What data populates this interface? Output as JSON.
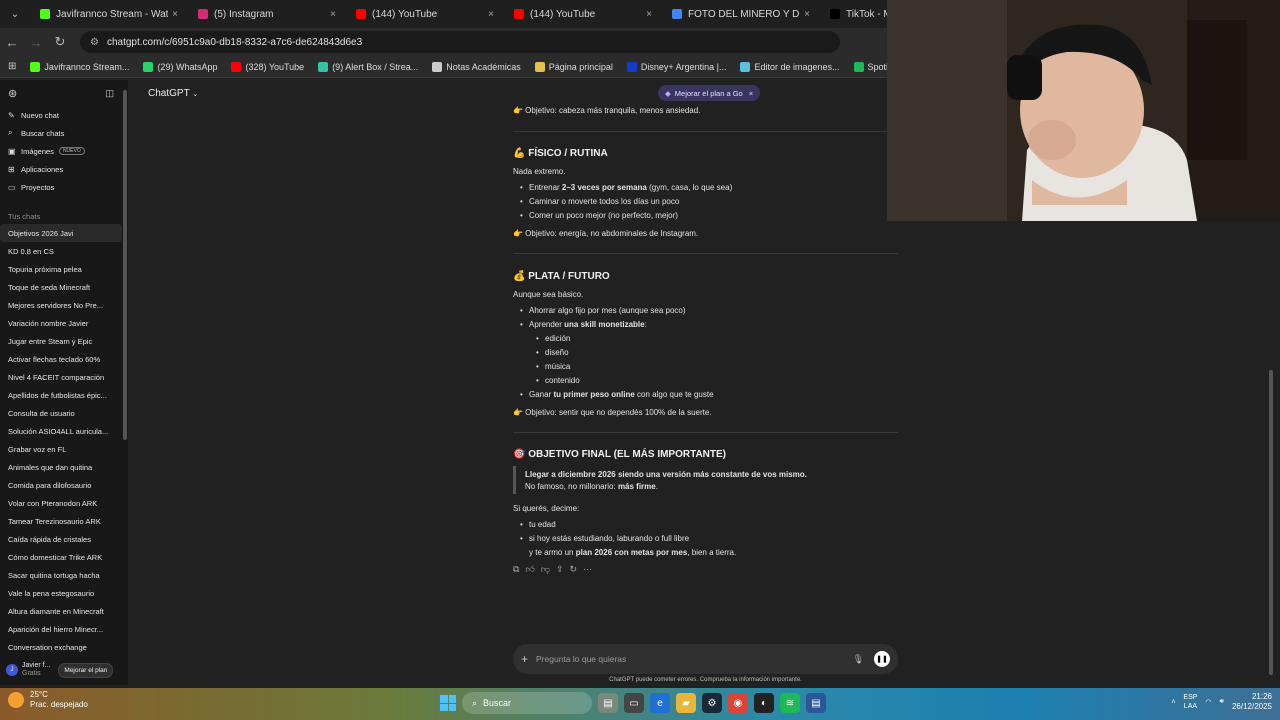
{
  "browser": {
    "tabs": [
      {
        "title": "Javifrannco Stream - Watch Live",
        "color": "#53fc18",
        "active": false
      },
      {
        "title": "(5) Instagram",
        "color": "#d62976",
        "active": false
      },
      {
        "title": "(144) YouTube",
        "color": "#ff0000",
        "active": false
      },
      {
        "title": "(144) YouTube",
        "color": "#ff0000",
        "active": false
      },
      {
        "title": "FOTO DEL MINERO Y DIAMANTE",
        "color": "#4285f4",
        "active": false
      },
      {
        "title": "TikTok - Make",
        "color": "#000000",
        "active": false
      }
    ],
    "url": "chatgpt.com/c/6951c9a0-db18-8332-a7c6-de624843d6e3",
    "bookmarks": [
      {
        "label": "Javifrannco Stream...",
        "color": "#53fc18"
      },
      {
        "label": "(29) WhatsApp",
        "color": "#25d366"
      },
      {
        "label": "(328) YouTube",
        "color": "#ff0000"
      },
      {
        "label": "(9) Alert Box / Strea...",
        "color": "#31c3a2"
      },
      {
        "label": "Notas Académicas",
        "color": "#cccccc"
      },
      {
        "label": "Página principal",
        "color": "#e5c04a"
      },
      {
        "label": "Disney+ Argentina |...",
        "color": "#113ccf"
      },
      {
        "label": "Editor de imagenes...",
        "color": "#5bc0de"
      },
      {
        "label": "Spotify - Reproduct...",
        "color": "#1db954"
      }
    ]
  },
  "sidebar": {
    "top_items": [
      {
        "icon": "edit-icon",
        "glyph": "✎",
        "label": "Nuevo chat"
      },
      {
        "icon": "search-icon",
        "glyph": "⌕",
        "label": "Buscar chats"
      },
      {
        "icon": "image-icon",
        "glyph": "▣",
        "label": "Imágenes",
        "badge": "NUEVO"
      },
      {
        "icon": "apps-icon",
        "glyph": "⊞",
        "label": "Aplicaciones"
      },
      {
        "icon": "folder-icon",
        "glyph": "▭",
        "label": "Proyectos"
      }
    ],
    "section_label": "Tus chats",
    "chats": [
      "Objetivos 2026 Javi",
      "KD 0.8 en CS",
      "Topuria próxima pelea",
      "Toque de seda Minecraft",
      "Mejores servidores No Pre...",
      "Variación nombre Javier",
      "Jugar entre Steam y Epic",
      "Activar flechas teclado 60%",
      "Nivel 4 FACEIT comparación",
      "Apellidos de futbolistas épic...",
      "Consulta de usuario",
      "Solución ASIO4ALL auricula...",
      "Grabar voz en FL",
      "Animales que dan quitina",
      "Comida para dilofosaurio",
      "Volar con Pteranodon ARK",
      "Tamear Terezinosaurio ARK",
      "Caída rápida de cristales",
      "Cómo domesticar Trike ARK",
      "Sacar quitina tortuga hacha",
      "Vale la pena estegosaurio",
      "Altura diamante en Minecraft",
      "Aparición del hierro Minecr...",
      "Conversation exchange"
    ],
    "user_name": "Javier f...",
    "user_plan": "Gratis",
    "upgrade_label": "Mejorar el plan"
  },
  "header": {
    "model": "ChatGPT",
    "go_badge": "Mejorar el plan a Go"
  },
  "message": {
    "line_top": "👉 Objetivo: cabeza más tranquila, menos ansiedad.",
    "fisico_title": "💪 FÍSICO / RUTINA",
    "fisico_intro": "Nada extremo.",
    "fisico_items": [
      {
        "pre": "Entrenar ",
        "bold": "2–3 veces por semana",
        "post": " (gym, casa, lo que sea)"
      },
      {
        "pre": "Caminar o moverte todos los días un poco",
        "bold": "",
        "post": ""
      },
      {
        "pre": "Comer un poco mejor (no perfecto, mejor)",
        "bold": "",
        "post": ""
      }
    ],
    "fisico_goal": "👉 Objetivo: energía, no abdominales de Instagram.",
    "plata_title": "💰 PLATA / FUTURO",
    "plata_intro": "Aunque sea básico.",
    "plata_item1": "Ahorrar algo fijo por mes (aunque sea poco)",
    "plata_item2_pre": "Aprender ",
    "plata_item2_bold": "una skill monetizable",
    "plata_item2_post": ":",
    "skills": [
      "edición",
      "diseño",
      "música",
      "contenido"
    ],
    "plata_item3_pre": "Ganar ",
    "plata_item3_bold": "tu primer peso online",
    "plata_item3_post": " con algo que te guste",
    "plata_goal": "👉 Objetivo: sentir que no dependés 100% de la suerte.",
    "final_title": "🎯 OBJETIVO FINAL (EL MÁS IMPORTANTE)",
    "quote_line1": "Llegar a diciembre 2026 siendo una versión más constante de vos mismo.",
    "quote_line2_pre": "No famoso, no millonario: ",
    "quote_line2_bold": "más firme",
    "quote_line2_post": ".",
    "ask_intro": "Si querés, decime:",
    "ask_item1": "tu edad",
    "ask_item2": "si hoy estás estudiando, laburando o full libre",
    "closing_pre": "y te armo un ",
    "closing_bold": "plan 2026 con metas por mes",
    "closing_post": ", bien a tierra."
  },
  "composer": {
    "placeholder": "Pregunta lo que quieras",
    "disclaimer": "ChatGPT puede cometer errores. Comprueba la información importante."
  },
  "taskbar": {
    "temperature": "25°C",
    "weather": "Prac. despejado",
    "search_label": "Buscar",
    "lang_top": "ESP",
    "lang_bottom": "LAA",
    "time": "21:26",
    "date": "26/12/2025"
  }
}
